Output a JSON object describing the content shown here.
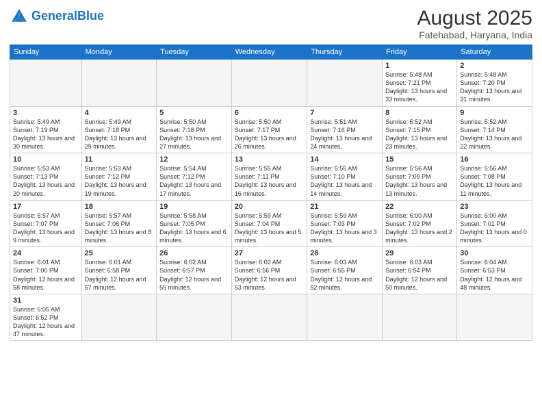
{
  "header": {
    "logo_general": "General",
    "logo_blue": "Blue",
    "month_title": "August 2025",
    "location": "Fatehabad, Haryana, India"
  },
  "days_of_week": [
    "Sunday",
    "Monday",
    "Tuesday",
    "Wednesday",
    "Thursday",
    "Friday",
    "Saturday"
  ],
  "weeks": [
    [
      {
        "day": "",
        "info": ""
      },
      {
        "day": "",
        "info": ""
      },
      {
        "day": "",
        "info": ""
      },
      {
        "day": "",
        "info": ""
      },
      {
        "day": "",
        "info": ""
      },
      {
        "day": "1",
        "info": "Sunrise: 5:48 AM\nSunset: 7:21 PM\nDaylight: 13 hours\nand 33 minutes."
      },
      {
        "day": "2",
        "info": "Sunrise: 5:48 AM\nSunset: 7:20 PM\nDaylight: 13 hours\nand 31 minutes."
      }
    ],
    [
      {
        "day": "3",
        "info": "Sunrise: 5:49 AM\nSunset: 7:19 PM\nDaylight: 13 hours\nand 30 minutes."
      },
      {
        "day": "4",
        "info": "Sunrise: 5:49 AM\nSunset: 7:18 PM\nDaylight: 13 hours\nand 29 minutes."
      },
      {
        "day": "5",
        "info": "Sunrise: 5:50 AM\nSunset: 7:18 PM\nDaylight: 13 hours\nand 27 minutes."
      },
      {
        "day": "6",
        "info": "Sunrise: 5:50 AM\nSunset: 7:17 PM\nDaylight: 13 hours\nand 26 minutes."
      },
      {
        "day": "7",
        "info": "Sunrise: 5:51 AM\nSunset: 7:16 PM\nDaylight: 13 hours\nand 24 minutes."
      },
      {
        "day": "8",
        "info": "Sunrise: 5:52 AM\nSunset: 7:15 PM\nDaylight: 13 hours\nand 23 minutes."
      },
      {
        "day": "9",
        "info": "Sunrise: 5:52 AM\nSunset: 7:14 PM\nDaylight: 13 hours\nand 22 minutes."
      }
    ],
    [
      {
        "day": "10",
        "info": "Sunrise: 5:53 AM\nSunset: 7:13 PM\nDaylight: 13 hours\nand 20 minutes."
      },
      {
        "day": "11",
        "info": "Sunrise: 5:53 AM\nSunset: 7:12 PM\nDaylight: 13 hours\nand 19 minutes."
      },
      {
        "day": "12",
        "info": "Sunrise: 5:54 AM\nSunset: 7:12 PM\nDaylight: 13 hours\nand 17 minutes."
      },
      {
        "day": "13",
        "info": "Sunrise: 5:55 AM\nSunset: 7:11 PM\nDaylight: 13 hours\nand 16 minutes."
      },
      {
        "day": "14",
        "info": "Sunrise: 5:55 AM\nSunset: 7:10 PM\nDaylight: 13 hours\nand 14 minutes."
      },
      {
        "day": "15",
        "info": "Sunrise: 5:56 AM\nSunset: 7:09 PM\nDaylight: 13 hours\nand 13 minutes."
      },
      {
        "day": "16",
        "info": "Sunrise: 5:56 AM\nSunset: 7:08 PM\nDaylight: 13 hours\nand 11 minutes."
      }
    ],
    [
      {
        "day": "17",
        "info": "Sunrise: 5:57 AM\nSunset: 7:07 PM\nDaylight: 13 hours\nand 9 minutes."
      },
      {
        "day": "18",
        "info": "Sunrise: 5:57 AM\nSunset: 7:06 PM\nDaylight: 13 hours\nand 8 minutes."
      },
      {
        "day": "19",
        "info": "Sunrise: 5:58 AM\nSunset: 7:05 PM\nDaylight: 13 hours\nand 6 minutes."
      },
      {
        "day": "20",
        "info": "Sunrise: 5:59 AM\nSunset: 7:04 PM\nDaylight: 13 hours\nand 5 minutes."
      },
      {
        "day": "21",
        "info": "Sunrise: 5:59 AM\nSunset: 7:03 PM\nDaylight: 13 hours\nand 3 minutes."
      },
      {
        "day": "22",
        "info": "Sunrise: 6:00 AM\nSunset: 7:02 PM\nDaylight: 13 hours\nand 2 minutes."
      },
      {
        "day": "23",
        "info": "Sunrise: 6:00 AM\nSunset: 7:01 PM\nDaylight: 13 hours\nand 0 minutes."
      }
    ],
    [
      {
        "day": "24",
        "info": "Sunrise: 6:01 AM\nSunset: 7:00 PM\nDaylight: 12 hours\nand 58 minutes."
      },
      {
        "day": "25",
        "info": "Sunrise: 6:01 AM\nSunset: 6:58 PM\nDaylight: 12 hours\nand 57 minutes."
      },
      {
        "day": "26",
        "info": "Sunrise: 6:02 AM\nSunset: 6:57 PM\nDaylight: 12 hours\nand 55 minutes."
      },
      {
        "day": "27",
        "info": "Sunrise: 6:02 AM\nSunset: 6:56 PM\nDaylight: 12 hours\nand 53 minutes."
      },
      {
        "day": "28",
        "info": "Sunrise: 6:03 AM\nSunset: 6:55 PM\nDaylight: 12 hours\nand 52 minutes."
      },
      {
        "day": "29",
        "info": "Sunrise: 6:03 AM\nSunset: 6:54 PM\nDaylight: 12 hours\nand 50 minutes."
      },
      {
        "day": "30",
        "info": "Sunrise: 6:04 AM\nSunset: 6:53 PM\nDaylight: 12 hours\nand 48 minutes."
      }
    ],
    [
      {
        "day": "31",
        "info": "Sunrise: 6:05 AM\nSunset: 6:52 PM\nDaylight: 12 hours\nand 47 minutes."
      },
      {
        "day": "",
        "info": ""
      },
      {
        "day": "",
        "info": ""
      },
      {
        "day": "",
        "info": ""
      },
      {
        "day": "",
        "info": ""
      },
      {
        "day": "",
        "info": ""
      },
      {
        "day": "",
        "info": ""
      }
    ]
  ]
}
